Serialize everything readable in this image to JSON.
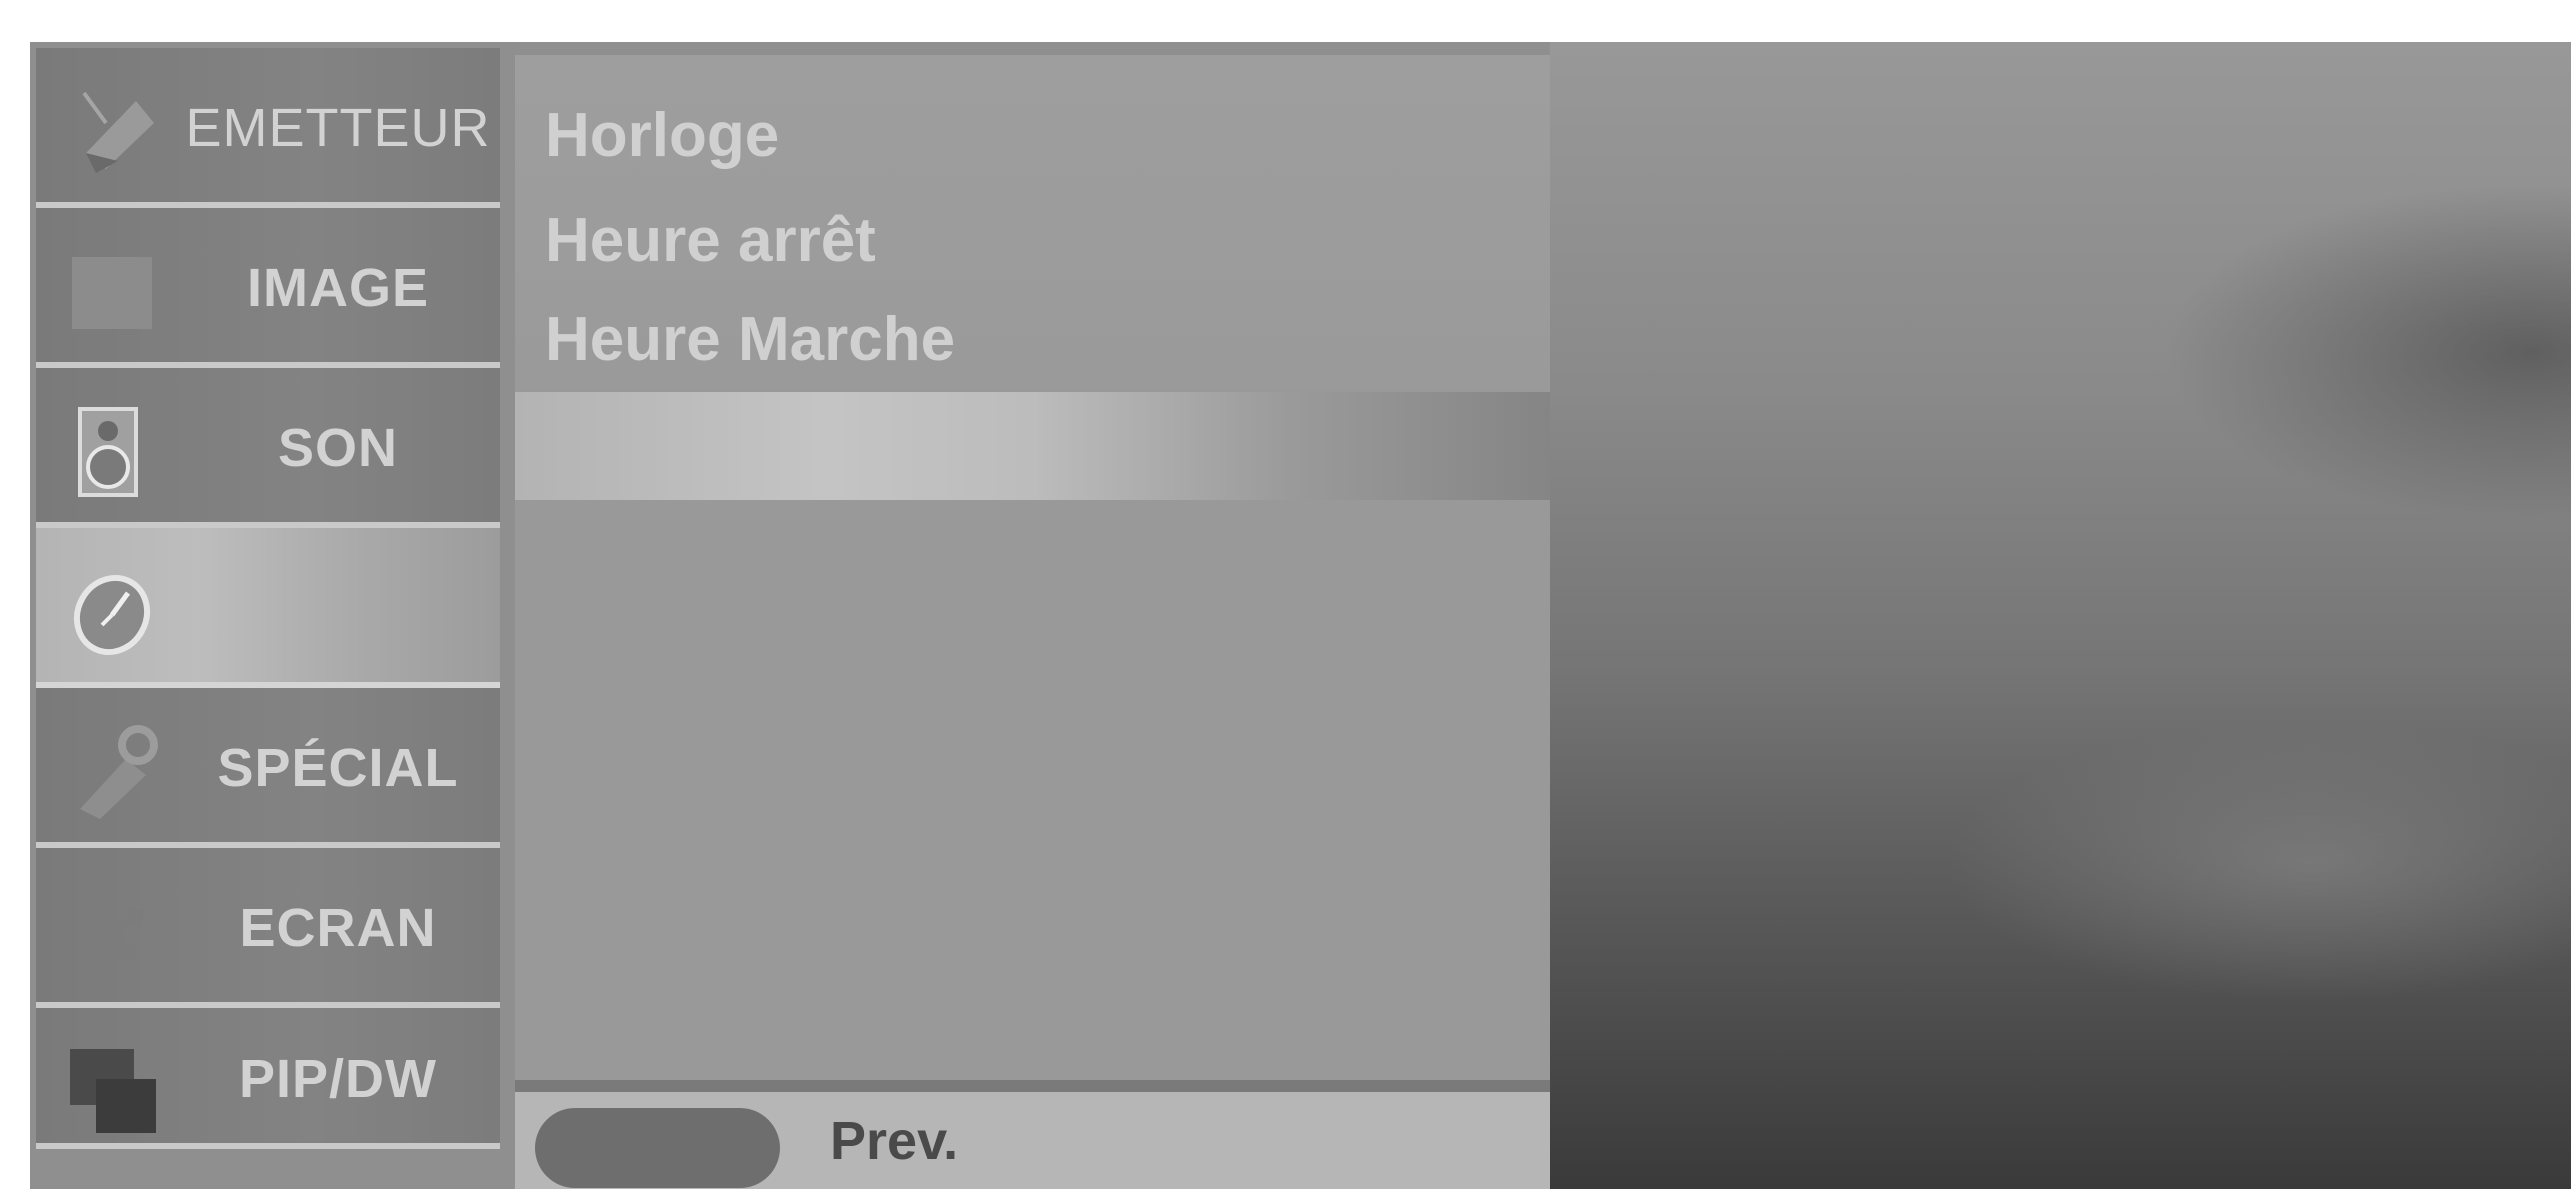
{
  "sidebar": {
    "items": [
      {
        "label": "EMETTEUR",
        "icon": "satellite-dish-icon"
      },
      {
        "label": "IMAGE",
        "icon": "picture-icon"
      },
      {
        "label": "SON",
        "icon": "speaker-icon"
      },
      {
        "label": "",
        "icon": "clock-icon",
        "active": true
      },
      {
        "label": "SPÉCIAL",
        "icon": "tag-icon"
      },
      {
        "label": "ECRAN",
        "icon": "move-arrows-icon"
      },
      {
        "label": "PIP/DW",
        "icon": "pip-icon"
      }
    ]
  },
  "menu": {
    "items": [
      "Horloge",
      "Heure arrêt",
      "Heure Marche"
    ]
  },
  "footer": {
    "prev_label": "Prev."
  }
}
